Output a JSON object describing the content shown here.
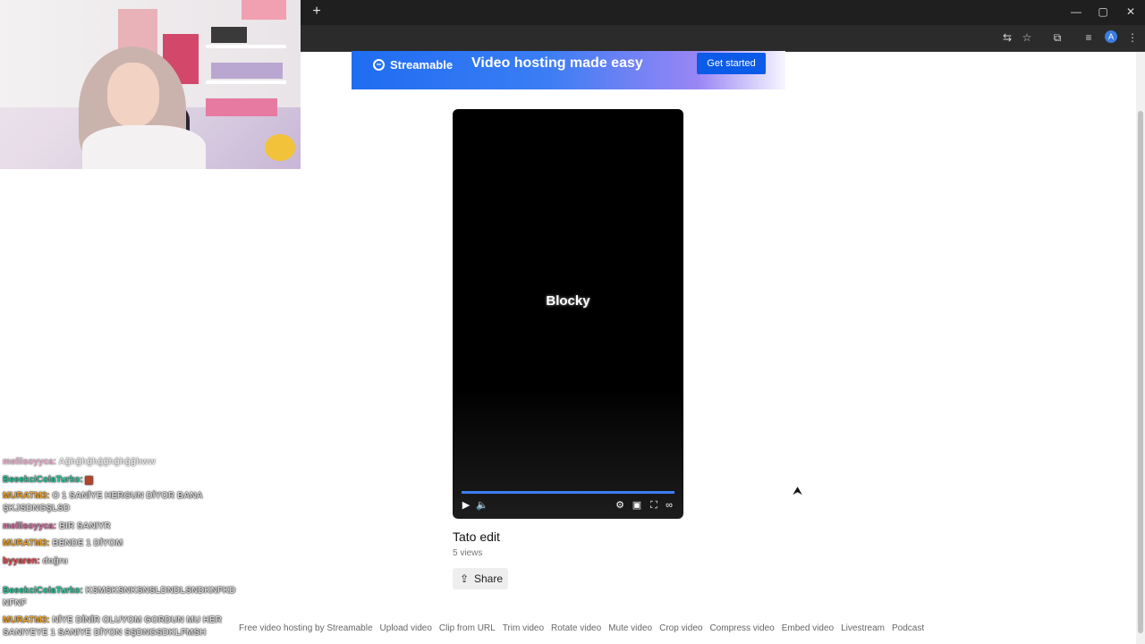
{
  "browser": {
    "new_tab": "+",
    "window_controls": [
      "—",
      "▢",
      "✕"
    ],
    "toolbar_icons": [
      "translate-icon",
      "star-icon",
      "extensions-icon",
      "media-icon"
    ],
    "profile_initial": "A",
    "menu": "⋮"
  },
  "banner": {
    "brand": "Streamable",
    "tagline": "Video hosting made easy",
    "cta": "Get started"
  },
  "video": {
    "overlay_text": "Blocky",
    "title": "Tato edit",
    "views": "5 views",
    "progress_fraction": 1.0,
    "share_label": "Share"
  },
  "footer_links": [
    "Free video hosting by Streamable",
    "Upload video",
    "Clip from URL",
    "Trim video",
    "Rotate video",
    "Mute video",
    "Crop video",
    "Compress video",
    "Embed video",
    "Livestream",
    "Podcast"
  ],
  "chat": [
    {
      "user": "mellisoyyca:",
      "text": "Ağhğhğhğğhğhğğhww",
      "color": "#d66fa3"
    },
    {
      "user": "BeeekciColaTurko:",
      "text": "▆",
      "color": "#27c49a"
    },
    {
      "user": "MURATM3:",
      "text": "O 1 SANİYE HERGUN DİYOR BANA",
      "text2": "ŞKJSDNGŞLSD",
      "color": "#f2a31f"
    },
    {
      "user": "mellisoyyca:",
      "text": "BIR SANIYR",
      "color": "#d66fa3"
    },
    {
      "user": "MURATM3:",
      "text": "BENDE 1 DİYOM",
      "color": "#f2a31f"
    },
    {
      "user": "byyaren:",
      "text": "doğru",
      "color": "#e0484d"
    },
    {
      "user": "BeeekciColaTurko:",
      "text": "KSMSKSNKSNSLDNDLSNDKNFKD",
      "text2": "NFNF",
      "color": "#27c49a"
    },
    {
      "user": "MURATM3:",
      "text": "NİYE DİNİR OLUYOM GORDUN MU HER",
      "text2": "SANIYEYE 1 SANIYE DİYON SŞDNGSDKLFMSH",
      "color": "#f2a31f"
    }
  ]
}
